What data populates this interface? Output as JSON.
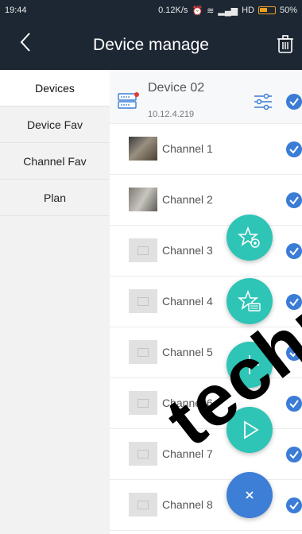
{
  "status": {
    "time": "19:44",
    "speed": "0.12K/s",
    "network": "HD",
    "battery": "50%"
  },
  "header": {
    "title": "Device manage"
  },
  "sidebar": {
    "items": [
      {
        "label": "Devices"
      },
      {
        "label": "Device Fav"
      },
      {
        "label": "Channel Fav"
      },
      {
        "label": "Plan"
      }
    ]
  },
  "device": {
    "name": "Device 02",
    "ip": "10.12.4.219"
  },
  "channels": [
    {
      "label": "Channel 1"
    },
    {
      "label": "Channel 2"
    },
    {
      "label": "Channel 3"
    },
    {
      "label": "Channel 4"
    },
    {
      "label": "Channel 5"
    },
    {
      "label": "Channel 6"
    },
    {
      "label": "Channel 7"
    },
    {
      "label": "Channel 8"
    }
  ],
  "watermark": "techn",
  "colors": {
    "appbar": "#1d2733",
    "fab": "#2ec4b6",
    "check": "#3a7cd6",
    "fab_close": "#3d7ed6"
  }
}
